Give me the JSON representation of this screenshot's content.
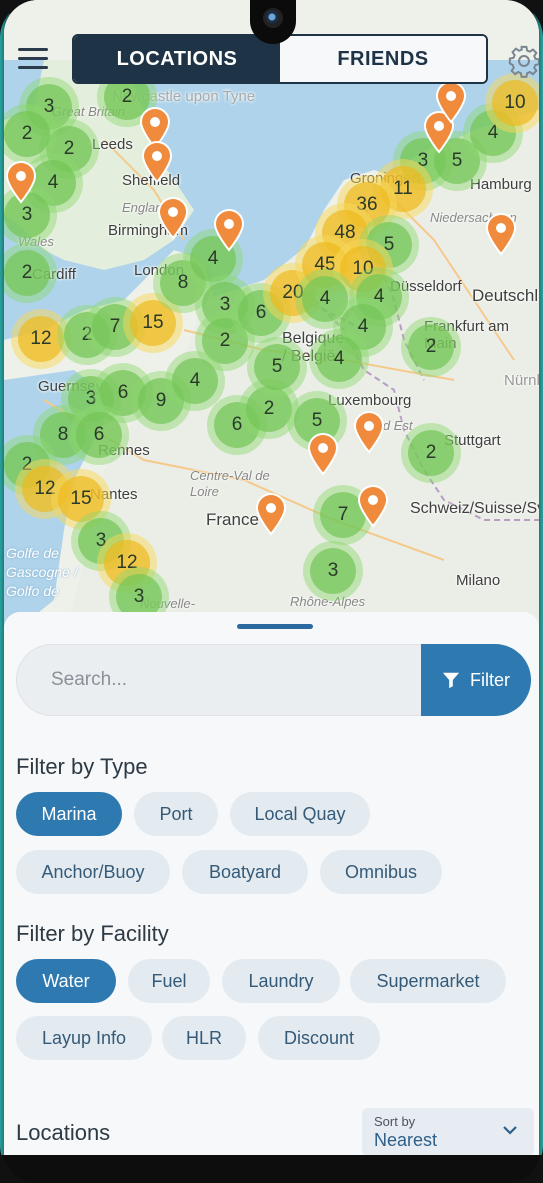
{
  "header": {
    "tabs": [
      {
        "label": "LOCATIONS",
        "active": true
      },
      {
        "label": "FRIENDS",
        "active": false
      }
    ],
    "menu_icon": "hamburger-icon",
    "settings_icon": "gear-icon"
  },
  "map": {
    "places": [
      "Newcastle upon Tyne",
      "Great Britain",
      "Leeds",
      "Sheffield",
      "England",
      "Birmingham",
      "Wales",
      "Cardiff",
      "London",
      "Groningen",
      "Hamburg",
      "Niedersachsen",
      "Düsseldorf",
      "Deutschland",
      "Frankfurt am Main",
      "Belgique / België",
      "Luxembourg",
      "Nürnberg",
      "Grand Est",
      "Stuttgart",
      "Guernsey",
      "Rennes",
      "Nantes",
      "Centre-Val de Loire",
      "France",
      "Schweiz/Suisse/Svizzera/Svizra",
      "Milano",
      "Golfe de Gascogne / Golfo de",
      "Nouvelle-",
      "Rhône-Alpes"
    ],
    "clusters": [
      {
        "count": "3",
        "color": "green"
      },
      {
        "count": "2",
        "color": "green"
      },
      {
        "count": "2",
        "color": "green"
      },
      {
        "count": "4",
        "color": "green"
      },
      {
        "count": "3",
        "color": "green"
      },
      {
        "count": "2",
        "color": "green"
      },
      {
        "count": "12",
        "color": "yellow"
      },
      {
        "count": "2",
        "color": "green"
      },
      {
        "count": "7",
        "color": "green"
      },
      {
        "count": "15",
        "color": "yellow"
      },
      {
        "count": "8",
        "color": "green"
      },
      {
        "count": "4",
        "color": "green"
      },
      {
        "count": "3",
        "color": "green"
      },
      {
        "count": "2",
        "color": "green"
      },
      {
        "count": "6",
        "color": "green"
      },
      {
        "count": "20",
        "color": "yellow"
      },
      {
        "count": "3",
        "color": "green"
      },
      {
        "count": "6",
        "color": "green"
      },
      {
        "count": "9",
        "color": "green"
      },
      {
        "count": "4",
        "color": "green"
      },
      {
        "count": "8",
        "color": "green"
      },
      {
        "count": "6",
        "color": "green"
      },
      {
        "count": "6",
        "color": "green"
      },
      {
        "count": "2",
        "color": "green"
      },
      {
        "count": "5",
        "color": "green"
      },
      {
        "count": "5",
        "color": "green"
      },
      {
        "count": "2",
        "color": "green"
      },
      {
        "count": "12",
        "color": "yellow"
      },
      {
        "count": "15",
        "color": "yellow"
      },
      {
        "count": "3",
        "color": "green"
      },
      {
        "count": "12",
        "color": "yellow"
      },
      {
        "count": "3",
        "color": "green"
      },
      {
        "count": "7",
        "color": "green"
      },
      {
        "count": "3",
        "color": "green"
      },
      {
        "count": "3",
        "color": "green"
      },
      {
        "count": "5",
        "color": "green"
      },
      {
        "count": "11",
        "color": "yellow"
      },
      {
        "count": "36",
        "color": "yellow"
      },
      {
        "count": "48",
        "color": "yellow"
      },
      {
        "count": "5",
        "color": "green"
      },
      {
        "count": "45",
        "color": "yellow"
      },
      {
        "count": "10",
        "color": "yellow"
      },
      {
        "count": "4",
        "color": "green"
      },
      {
        "count": "4",
        "color": "green"
      },
      {
        "count": "4",
        "color": "green"
      },
      {
        "count": "4",
        "color": "green"
      },
      {
        "count": "2",
        "color": "green"
      },
      {
        "count": "2",
        "color": "green"
      },
      {
        "count": "4",
        "color": "green"
      },
      {
        "count": "10",
        "color": "yellow"
      },
      {
        "count": "2",
        "color": "green"
      }
    ],
    "pin_icon": "map-pin-icon"
  },
  "sheet": {
    "search_placeholder": "Search...",
    "filter_label": "Filter",
    "filter_icon": "funnel-icon",
    "type_title": "Filter by Type",
    "type_chips": [
      {
        "label": "Marina",
        "active": true
      },
      {
        "label": "Port",
        "active": false
      },
      {
        "label": "Local Quay",
        "active": false
      },
      {
        "label": "Anchor/Buoy",
        "active": false
      },
      {
        "label": "Boatyard",
        "active": false
      },
      {
        "label": "Omnibus",
        "active": false
      }
    ],
    "facility_title": "Filter by Facility",
    "facility_chips": [
      {
        "label": "Water",
        "active": true
      },
      {
        "label": "Fuel",
        "active": false
      },
      {
        "label": "Laundry",
        "active": false
      },
      {
        "label": "Supermarket",
        "active": false
      },
      {
        "label": "Layup Info",
        "active": false
      },
      {
        "label": "HLR",
        "active": false
      },
      {
        "label": "Discount",
        "active": false
      }
    ],
    "locations_title": "Locations",
    "sort_label": "Sort by",
    "sort_value": "Nearest"
  },
  "colors": {
    "primary": "#2e79b0",
    "navy": "#1e3346",
    "cluster_green": "#78c85a",
    "cluster_yellow": "#f0be28",
    "pin": "#f08a3c"
  }
}
